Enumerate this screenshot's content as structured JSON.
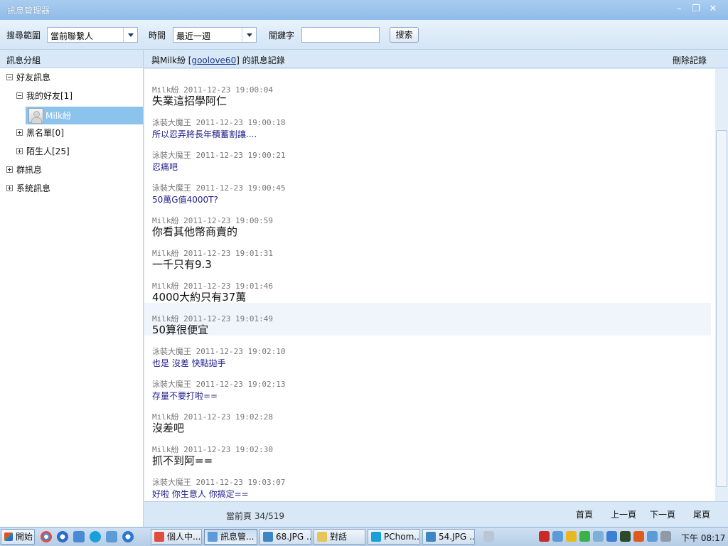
{
  "window": {
    "title": "訊息管理器",
    "minimize": "–",
    "maximize": "❐",
    "close": "✕"
  },
  "toolbar": {
    "scope_label": "搜尋範圍",
    "scope_value": "當前聯繫人",
    "time_label": "時間",
    "time_value": "最近一週",
    "keyword_label": "關鍵字",
    "keyword_value": "",
    "search_button": "搜索"
  },
  "left_panel": {
    "title": "訊息分組",
    "tree": {
      "friend_msgs": "好友訊息",
      "my_friends": "我的好友[1]",
      "selected_contact": "Milk紛",
      "blacklist": "黑名單[0]",
      "strangers": "陌生人[25]",
      "group_msgs": "群訊息",
      "system_msgs": "系統訊息"
    }
  },
  "chat_header": {
    "prefix": "與Milk紛 [",
    "user_id": "goolove60",
    "suffix": "] 的訊息記錄",
    "delete": "刪除記錄"
  },
  "messages": [
    {
      "sender": "Milk紛",
      "time": "2011-12-23 19:00:04",
      "text": "失業這招學阿仁",
      "style": "big"
    },
    {
      "sender": "泳裝大魔王",
      "time": "2011-12-23 19:00:18",
      "text": "所以忍弄將長年積蓄割讓....",
      "style": "small"
    },
    {
      "sender": "泳裝大魔王",
      "time": "2011-12-23 19:00:21",
      "text": "忍痛吧",
      "style": "small"
    },
    {
      "sender": "泳裝大魔王",
      "time": "2011-12-23 19:00:45",
      "text": "50萬G值4000T?",
      "style": "small"
    },
    {
      "sender": "Milk紛",
      "time": "2011-12-23 19:00:59",
      "text": "你看其他幣商賣的",
      "style": "big"
    },
    {
      "sender": "Milk紛",
      "time": "2011-12-23 19:01:31",
      "text": "一千只有9.3",
      "style": "big"
    },
    {
      "sender": "Milk紛",
      "time": "2011-12-23 19:01:46",
      "text": "4000大約只有37萬",
      "style": "big"
    },
    {
      "sender": "Milk紛",
      "time": "2011-12-23 19:01:49",
      "text": "50算很便宜",
      "style": "big"
    },
    {
      "sender": "泳裝大魔王",
      "time": "2011-12-23 19:02:10",
      "text": "也是 沒差 快點拋手",
      "style": "small"
    },
    {
      "sender": "泳裝大魔王",
      "time": "2011-12-23 19:02:13",
      "text": "存量不要打啦==",
      "style": "small"
    },
    {
      "sender": "Milk紛",
      "time": "2011-12-23 19:02:28",
      "text": "沒差吧",
      "style": "big"
    },
    {
      "sender": "Milk紛",
      "time": "2011-12-23 19:02:30",
      "text": "抓不到阿==",
      "style": "big"
    },
    {
      "sender": "泳裝大魔王",
      "time": "2011-12-23 19:03:07",
      "text": "好啦 你生意人 你搞定==",
      "style": "small"
    }
  ],
  "highlighted_message_index": 7,
  "footer": {
    "current_page": "當前頁 34/519",
    "first": "首頁",
    "prev": "上一頁",
    "next": "下一頁",
    "last": "尾頁"
  },
  "taskbar": {
    "start": "開始",
    "tasks": [
      {
        "label": "個人中...",
        "icon": "chrome-icon",
        "active": false
      },
      {
        "label": "訊息管...",
        "icon": "chat-icon",
        "active": true
      },
      {
        "label": "68.JPG ...",
        "icon": "image-icon",
        "active": false
      },
      {
        "label": "對話",
        "icon": "folder-icon",
        "active": false
      },
      {
        "label": "PChom...",
        "icon": "skype-icon",
        "active": false
      },
      {
        "label": "54.JPG ...",
        "icon": "image-icon",
        "active": false
      }
    ],
    "clock": "下午 08:17"
  }
}
